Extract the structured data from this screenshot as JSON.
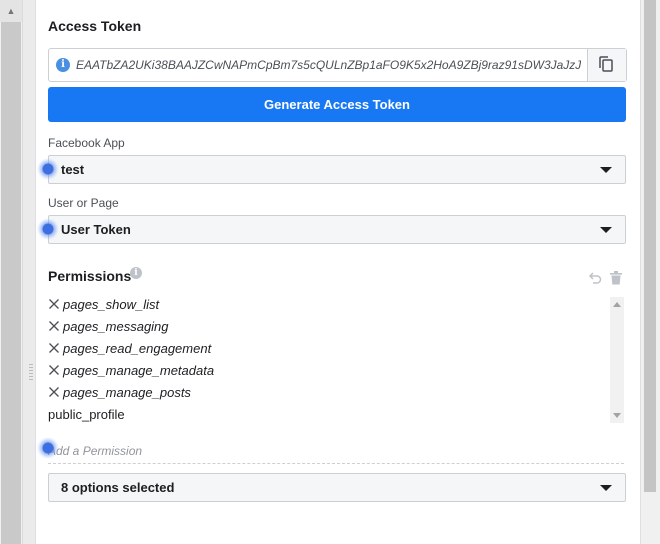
{
  "access_token": {
    "heading": "Access Token",
    "info_icon": "i",
    "token_value": "EAATbZA2UKi38BAAJZCwNAPmCpBm7s5cQULnZBp1aFO9K5x2HoA9ZBj9raz91sDW3JaJzJ",
    "copy_icon": "copy-icon",
    "generate_button": "Generate Access Token"
  },
  "facebook_app": {
    "label": "Facebook App",
    "value": "test"
  },
  "user_or_page": {
    "label": "User or Page",
    "value": "User Token"
  },
  "permissions": {
    "heading": "Permissions",
    "info_icon": "i",
    "items": [
      {
        "name": "pages_show_list",
        "removable": true
      },
      {
        "name": "pages_messaging",
        "removable": true
      },
      {
        "name": "pages_read_engagement",
        "removable": true
      },
      {
        "name": "pages_manage_metadata",
        "removable": true
      },
      {
        "name": "pages_manage_posts",
        "removable": true
      },
      {
        "name": "public_profile",
        "removable": false
      }
    ],
    "add_placeholder": "Add a Permission",
    "summary": "8 options selected"
  },
  "colors": {
    "primary": "#1877f2",
    "text": "#1c1e21",
    "muted": "#90949c",
    "border": "#ccd0d5",
    "cursor_dot": "#3d6fe0"
  }
}
